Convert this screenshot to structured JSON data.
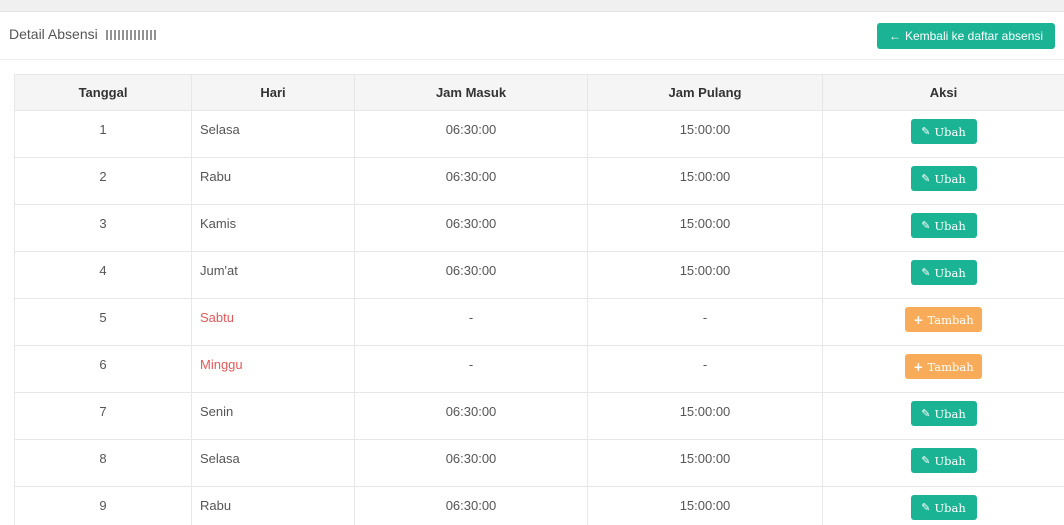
{
  "header": {
    "title": "Detail Absensi",
    "back_button": {
      "label": "Kembali ke daftar absensi",
      "icon": "arrow-left-icon"
    }
  },
  "colors": {
    "primary": "#1ab394",
    "warning": "#f8ac59",
    "weekend_text": "#e05a5a"
  },
  "table": {
    "columns": [
      "Tanggal",
      "Hari",
      "Jam Masuk",
      "Jam Pulang",
      "Aksi"
    ],
    "rows": [
      {
        "tanggal": "1",
        "hari": "Selasa",
        "jam_masuk": "06:30:00",
        "jam_pulang": "15:00:00",
        "aksi": "Ubah",
        "type": "edit"
      },
      {
        "tanggal": "2",
        "hari": "Rabu",
        "jam_masuk": "06:30:00",
        "jam_pulang": "15:00:00",
        "aksi": "Ubah",
        "type": "edit"
      },
      {
        "tanggal": "3",
        "hari": "Kamis",
        "jam_masuk": "06:30:00",
        "jam_pulang": "15:00:00",
        "aksi": "Ubah",
        "type": "edit"
      },
      {
        "tanggal": "4",
        "hari": "Jum'at",
        "jam_masuk": "06:30:00",
        "jam_pulang": "15:00:00",
        "aksi": "Ubah",
        "type": "edit"
      },
      {
        "tanggal": "5",
        "hari": "Sabtu",
        "jam_masuk": "-",
        "jam_pulang": "-",
        "aksi": "Tambah",
        "type": "add"
      },
      {
        "tanggal": "6",
        "hari": "Minggu",
        "jam_masuk": "-",
        "jam_pulang": "-",
        "aksi": "Tambah",
        "type": "add"
      },
      {
        "tanggal": "7",
        "hari": "Senin",
        "jam_masuk": "06:30:00",
        "jam_pulang": "15:00:00",
        "aksi": "Ubah",
        "type": "edit"
      },
      {
        "tanggal": "8",
        "hari": "Selasa",
        "jam_masuk": "06:30:00",
        "jam_pulang": "15:00:00",
        "aksi": "Ubah",
        "type": "edit"
      },
      {
        "tanggal": "9",
        "hari": "Rabu",
        "jam_masuk": "06:30:00",
        "jam_pulang": "15:00:00",
        "aksi": "Ubah",
        "type": "edit"
      }
    ]
  }
}
